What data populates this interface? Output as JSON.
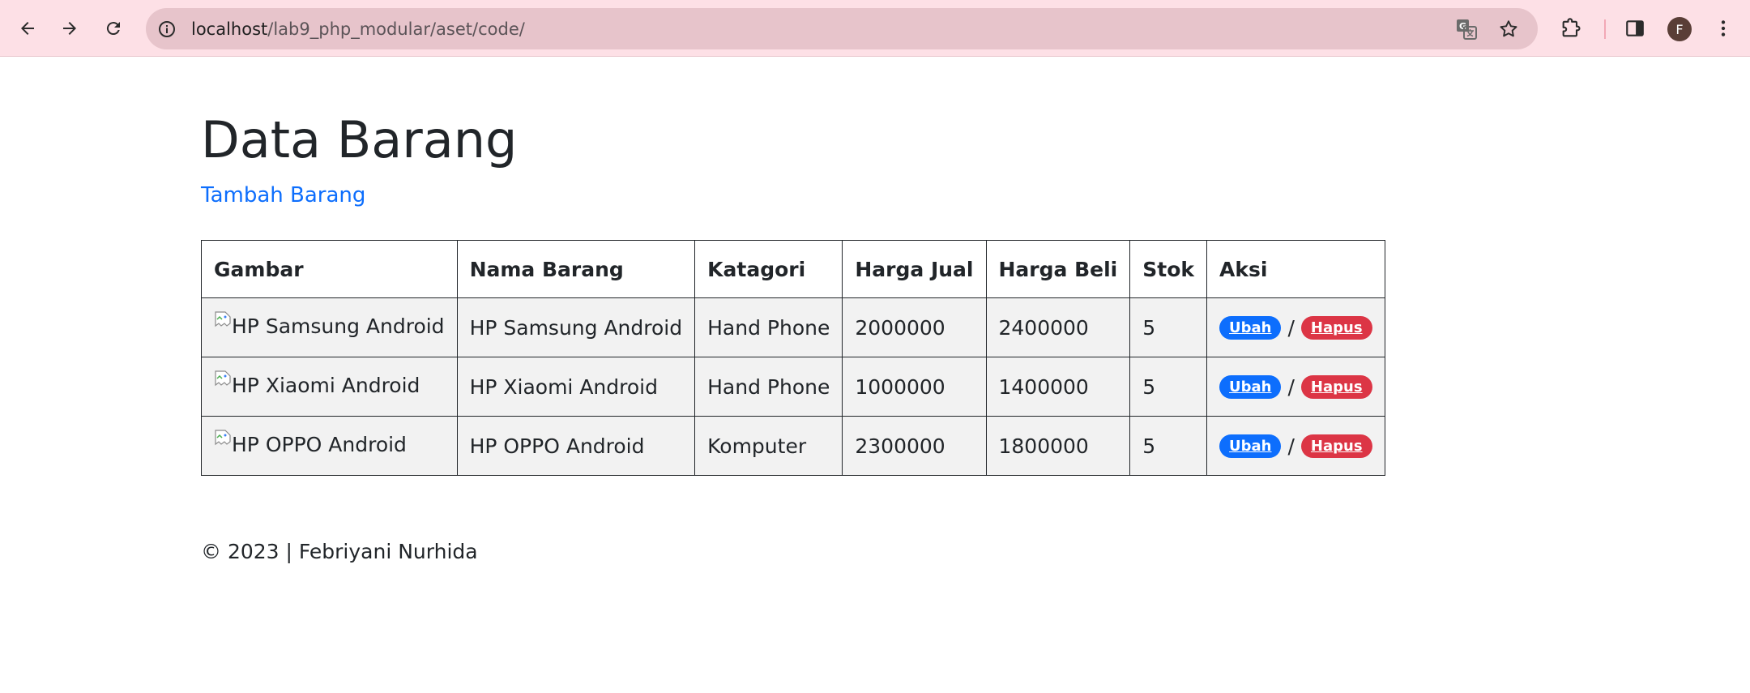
{
  "browser": {
    "url_host": "localhost",
    "url_path": "/lab9_php_modular/aset/code/",
    "profile_initial": "F"
  },
  "page": {
    "title": "Data Barang",
    "add_link": "Tambah Barang",
    "footer": "© 2023 | Febriyani Nurhida"
  },
  "table": {
    "headers": [
      "Gambar",
      "Nama Barang",
      "Katagori",
      "Harga Jual",
      "Harga Beli",
      "Stok",
      "Aksi"
    ],
    "rows": [
      {
        "gambar_alt": "HP Samsung Android",
        "nama": "HP Samsung Android",
        "kategori": "Hand Phone",
        "harga_jual": "2000000",
        "harga_beli": "2400000",
        "stok": "5",
        "ubah": "Ubah",
        "sep": "/",
        "hapus": "Hapus"
      },
      {
        "gambar_alt": "HP Xiaomi Android",
        "nama": "HP Xiaomi Android",
        "kategori": "Hand Phone",
        "harga_jual": "1000000",
        "harga_beli": "1400000",
        "stok": "5",
        "ubah": "Ubah",
        "sep": "/",
        "hapus": "Hapus"
      },
      {
        "gambar_alt": "HP OPPO Android",
        "nama": "HP OPPO Android",
        "kategori": "Komputer",
        "harga_jual": "2300000",
        "harga_beli": "1800000",
        "stok": "5",
        "ubah": "Ubah",
        "sep": "/",
        "hapus": "Hapus"
      }
    ]
  },
  "colors": {
    "chrome_bg": "#fde0e6",
    "omnibox_bg": "#e7c4cb",
    "link": "#0d6efd",
    "edit_badge": "#0d6efd",
    "delete_badge": "#dc3545",
    "row_bg": "#f2f2f2"
  },
  "icons": [
    "back-icon",
    "forward-icon",
    "reload-icon",
    "site-info-icon",
    "translate-icon",
    "bookmark-star-icon",
    "extensions-icon",
    "side-panel-icon",
    "profile-avatar",
    "menu-dots-icon",
    "broken-image-icon"
  ]
}
